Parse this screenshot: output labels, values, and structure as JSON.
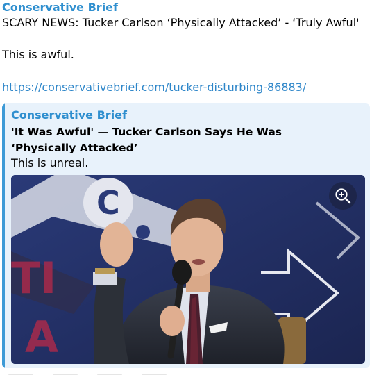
{
  "message": {
    "channel_name": "Conservative Brief",
    "headline": "SCARY NEWS: Tucker Carlson ‘Physically Attacked’ - ‘Truly Awful'",
    "comment": "This is awful.",
    "link": "https://conservativebrief.com/tucker-disturbing-86883/"
  },
  "preview": {
    "site_name": "Conservative Brief",
    "title": "'It Was Awful' — Tucker Carlson Says He Was ‘Physically Attacked’",
    "description": "This is unreal.",
    "image_icon": "zoom-in-icon",
    "image_subject": "man in suit speaking into microphone"
  },
  "colors": {
    "accent": "#2f8fcf",
    "link": "#2e86c9",
    "preview_bg": "#e8f2fb",
    "preview_bar": "#3d9ad6"
  }
}
